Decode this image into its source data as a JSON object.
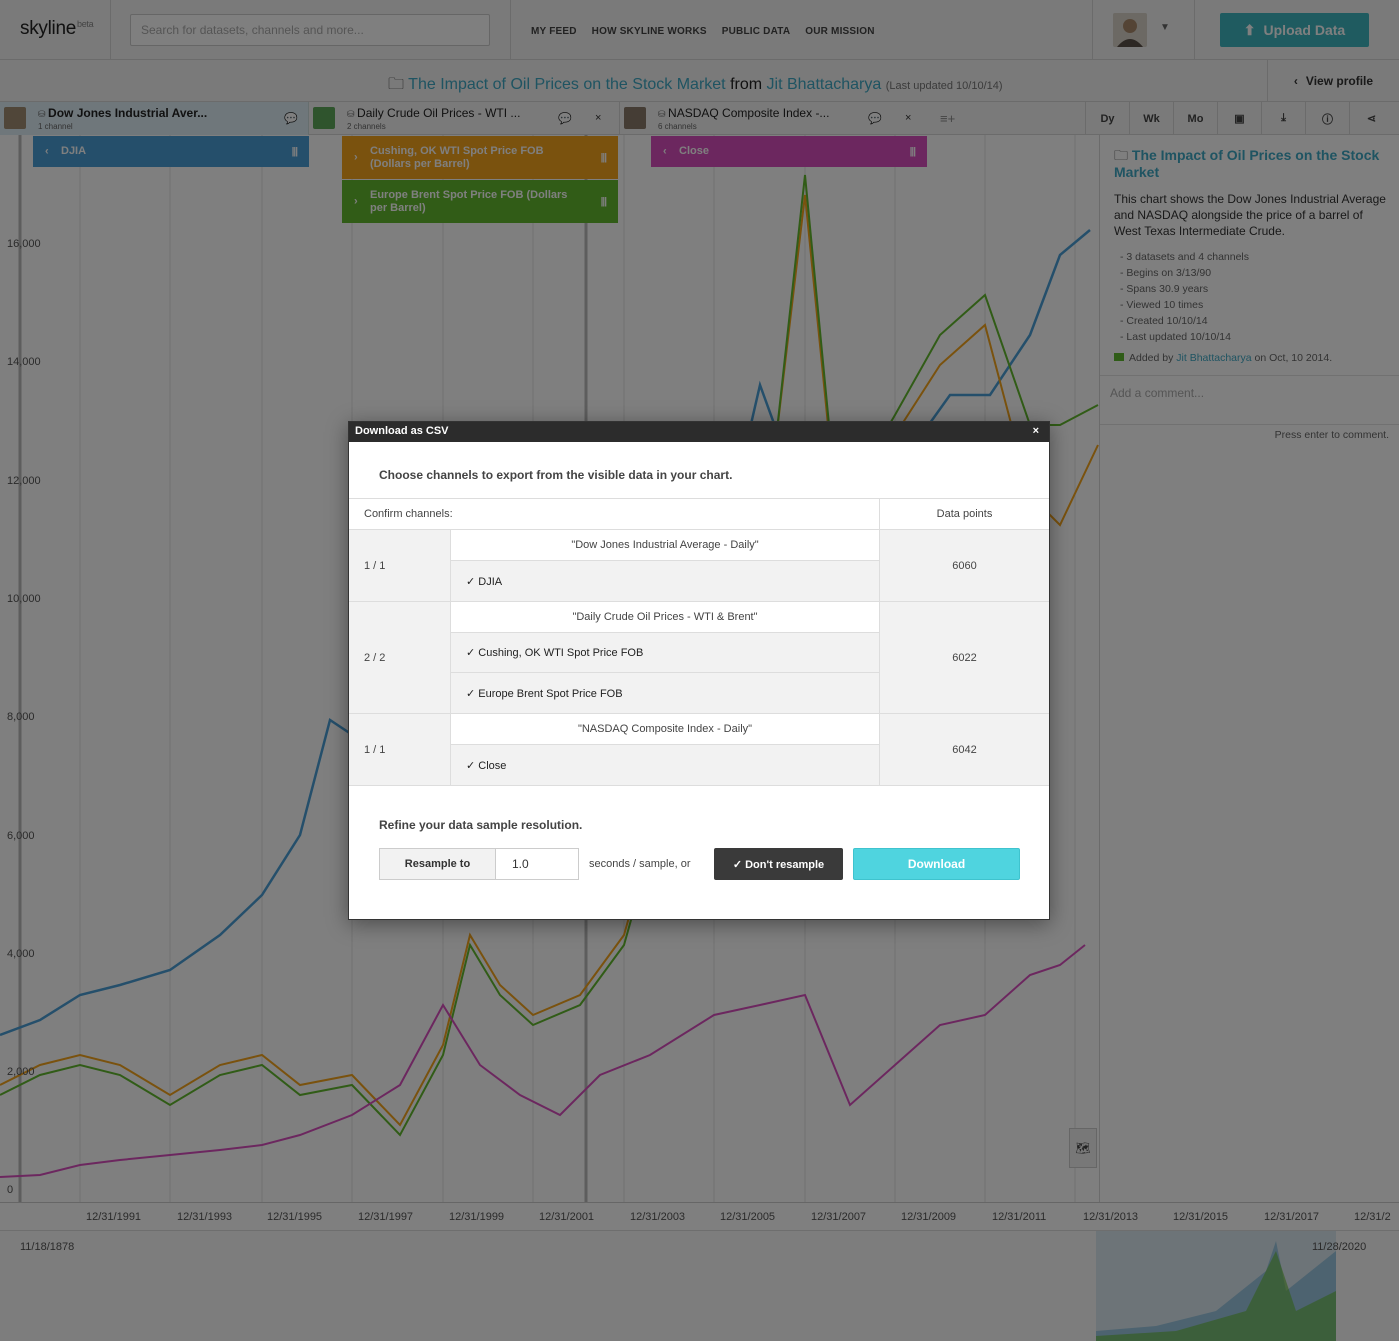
{
  "nav": {
    "logo": "skyline",
    "logo_badge": "beta",
    "search_placeholder": "Search for datasets, channels and more...",
    "links": [
      "MY FEED",
      "HOW SKYLINE WORKS",
      "PUBLIC DATA",
      "OUR MISSION"
    ],
    "upload_label": "Upload Data",
    "accent": "#3fb7c1"
  },
  "titlebar": {
    "title": "The Impact of Oil Prices on the Stock Market",
    "from": "from",
    "author": "Jit Bhattacharya",
    "updated": "(Last updated 10/10/14)",
    "view_profile": "View profile"
  },
  "datasets": [
    {
      "name": "Dow Jones Industrial Aver...",
      "channels": "1 channel"
    },
    {
      "name": "Daily Crude Oil Prices - WTI ...",
      "channels": "2 channels"
    },
    {
      "name": "NASDAQ Composite Index -...",
      "channels": "6 channels"
    }
  ],
  "tools": [
    "Dy",
    "Wk",
    "Mo"
  ],
  "chips": {
    "djia": {
      "label": "DJIA",
      "color": "#4a9fd6"
    },
    "wti": {
      "label": "Cushing, OK WTI Spot Price FOB (Dollars per Barrel)",
      "color": "#f4a41c"
    },
    "brent": {
      "label": "Europe Brent Spot Price FOB (Dollars per Barrel)",
      "color": "#62b92e"
    },
    "close": {
      "label": "Close",
      "color": "#d94fbf"
    }
  },
  "chart": {
    "y_ticks": [
      "16,000",
      "14,000",
      "12,000",
      "10,000",
      "8,000",
      "6,000",
      "4,000",
      "2,000",
      "0"
    ],
    "x_ticks": [
      "12/31/1991",
      "12/31/1993",
      "12/31/1995",
      "12/31/1997",
      "12/31/1999",
      "12/31/2001",
      "12/31/2003",
      "12/31/2005",
      "12/31/2007",
      "12/31/2009",
      "12/31/2011",
      "12/31/2013",
      "12/31/2015",
      "12/31/2017",
      "12/31/2"
    ],
    "overview_start": "11/18/1878",
    "overview_end": "11/28/2020"
  },
  "panel": {
    "title": "The Impact of Oil Prices on the Stock Market",
    "description": "This chart shows the Dow Jones Industrial Average and NASDAQ alongside the price of a barrel of West Texas Intermediate Crude.",
    "facts": [
      "- 3 datasets and 4 channels",
      "- Begins on 3/13/90",
      "- Spans 30.9 years",
      "- Viewed 10 times",
      "- Created 10/10/14",
      "- Last updated 10/10/14"
    ],
    "added_prefix": "Added by",
    "added_author": "Jit Bhattacharya",
    "added_suffix": "on Oct, 10 2014.",
    "comment_placeholder": "Add a comment...",
    "comment_hint": "Press enter to comment."
  },
  "modal": {
    "title": "Download as CSV",
    "close": "×",
    "intro": "Choose channels to export from the visible data in your chart.",
    "col_channels": "Confirm channels:",
    "col_points": "Data points",
    "groups": [
      {
        "count": "1 / 1",
        "dataset": "\"Dow Jones Industrial Average - Daily\"",
        "channels": [
          "✓ DJIA"
        ],
        "points": "6060"
      },
      {
        "count": "2 / 2",
        "dataset": "\"Daily Crude Oil Prices - WTI & Brent\"",
        "channels": [
          "✓ Cushing, OK WTI Spot Price FOB",
          "✓ Europe Brent Spot Price FOB"
        ],
        "points": "6022"
      },
      {
        "count": "1 / 1",
        "dataset": "\"NASDAQ Composite Index - Daily\"",
        "channels": [
          "✓ Close"
        ],
        "points": "6042"
      }
    ],
    "refine": "Refine your data sample resolution.",
    "resample_label": "Resample to",
    "resample_value": "1.0",
    "unit": "seconds / sample, or",
    "dont_resample": "✓ Don't resample",
    "download": "Download"
  }
}
